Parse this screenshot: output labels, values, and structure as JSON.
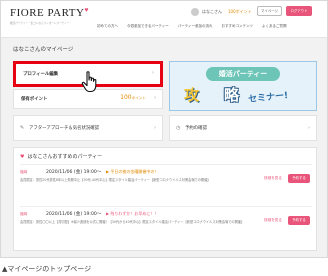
{
  "header": {
    "logo": "FIORE PARTY",
    "logo_sub": "婚活パーティー・街コンならフィオーレパーティー",
    "user_name": "はなこさん",
    "user_points": "100ポイント",
    "mypage_label": "マイページ",
    "logout_label": "ログアウト",
    "nav": [
      "初めての方へ",
      "今週参加できるパーティー",
      "パーティー参加の流れ",
      "おすすめコンテンツ",
      "よくあるご質問"
    ]
  },
  "page_title": "はなこさんのマイページ",
  "cards": {
    "profile_label": "プロフィール編集",
    "points_label": "保有ポイント",
    "points_value": "100",
    "points_unit": "ポイント",
    "approach_label": "アフターアプローチ＆気名状況確認",
    "reserve_label": "予約の確認"
  },
  "banner": {
    "pill": "婚活パーティー",
    "kou": "攻",
    "ryaku": "略",
    "seminar": "セミナー!"
  },
  "recommend": {
    "title": "はなこさんおすすめのパーティー",
    "events": [
      {
        "area": "福岡",
        "date": "2020/11/06 (金) 19:00〜",
        "badge": "▶ 平日の夜の金曜開催中の！",
        "desc": "会員限定：男性20代男性8年以上勤務中止【30代-40代中心】限定スタイル婚活パーティー【新型コロナウイルス対策会場での開催】",
        "detail": "詳細を見る",
        "book": "予約する"
      },
      {
        "area": "福岡",
        "date": "2020/11/06 (金) 19:00〜",
        "badge": "▶ 残りわずか！お早めに！！",
        "desc": "会員限定：男性〇〇以上【貸切型】※最少連続を公式に開催！【30代から40代中心】限定スタイル婚活パーティー【新型コロナウイルス対策会場での開催】",
        "detail": "詳細を見る",
        "book": "予約する"
      }
    ]
  },
  "caption": "▲マイページのトップページ",
  "colors": {
    "accent": "#e9547a",
    "highlight": "#e60012",
    "points": "#e08a00"
  }
}
